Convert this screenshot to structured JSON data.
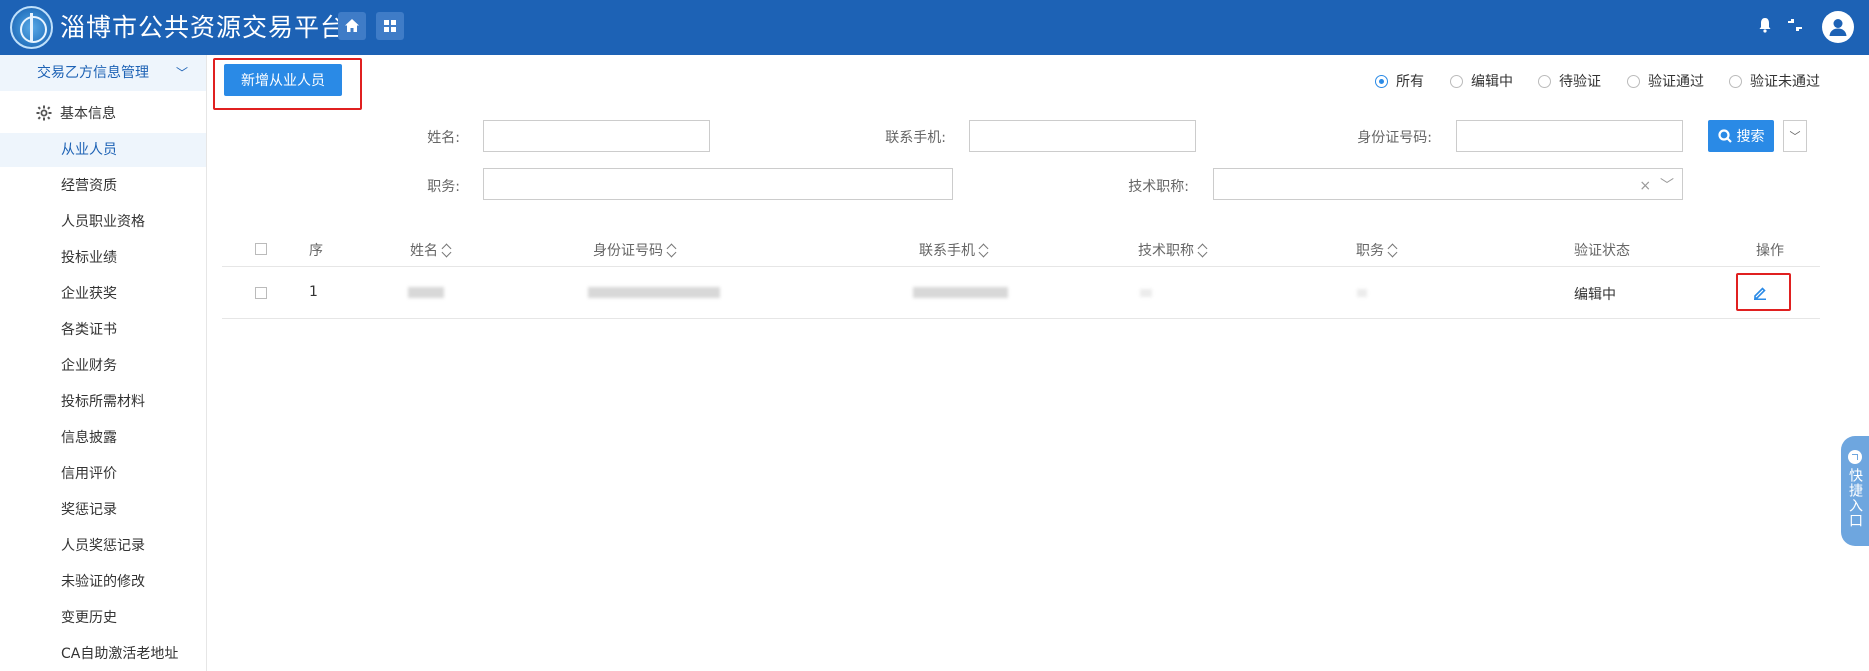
{
  "header": {
    "title": "淄博市公共资源交易平台",
    "icons": [
      "home-icon",
      "grid-icon",
      "bell-icon",
      "switch-icon",
      "user-icon"
    ]
  },
  "sidebar": {
    "group_label": "交易乙方信息管理",
    "section_label": "基本信息",
    "items": [
      {
        "label": "从业人员",
        "active": true
      },
      {
        "label": "经营资质"
      },
      {
        "label": "人员职业资格"
      },
      {
        "label": "投标业绩"
      },
      {
        "label": "企业获奖"
      },
      {
        "label": "各类证书"
      },
      {
        "label": "企业财务"
      },
      {
        "label": "投标所需材料"
      },
      {
        "label": "信息披露"
      },
      {
        "label": "信用评价"
      },
      {
        "label": "奖惩记录"
      },
      {
        "label": "人员奖惩记录"
      },
      {
        "label": "未验证的修改"
      },
      {
        "label": "变更历史"
      },
      {
        "label": "CA自助激活老地址"
      }
    ]
  },
  "toolbar": {
    "add_label": "新增从业人员"
  },
  "filter_status": {
    "options": [
      "所有",
      "编辑中",
      "待验证",
      "验证通过",
      "验证未通过"
    ],
    "selected": "所有"
  },
  "search_form": {
    "name_label": "姓名:",
    "phone_label": "联系手机:",
    "id_label": "身份证号码:",
    "position_label": "职务:",
    "title_label": "技术职称:",
    "search_label": "搜索",
    "clear_glyph": "×"
  },
  "table": {
    "columns": [
      "序",
      "姓名",
      "身份证号码",
      "联系手机",
      "技术职称",
      "职务",
      "验证状态",
      "操作"
    ],
    "rows": [
      {
        "index": "1",
        "status": "编辑中"
      }
    ]
  },
  "quick_entry": {
    "label": "快捷入口"
  },
  "colors": {
    "header_bg": "#1d62b5",
    "primary": "#2a8ae6",
    "highlight_box": "#e02020"
  }
}
